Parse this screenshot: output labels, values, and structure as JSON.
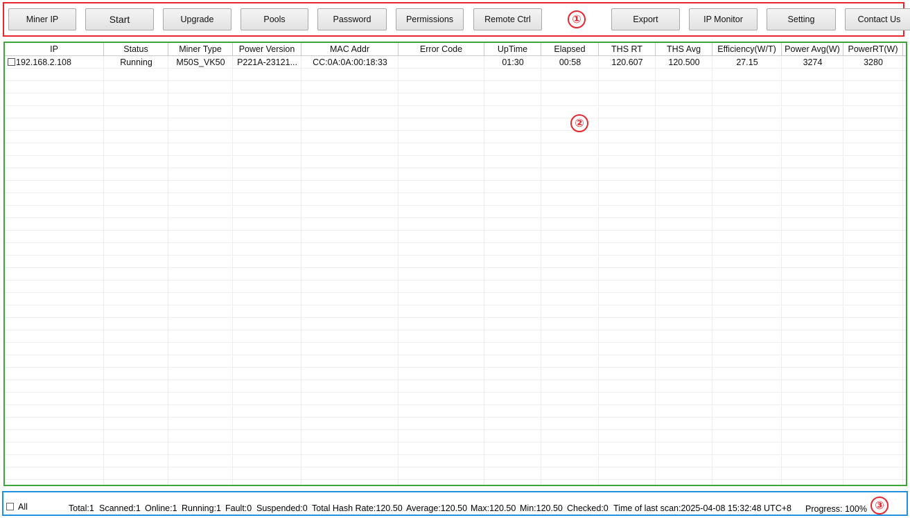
{
  "toolbar": {
    "buttons": [
      "Miner IP",
      "Start",
      "Upgrade",
      "Pools",
      "Password",
      "Permissions",
      "Remote Ctrl",
      "Export",
      "IP Monitor",
      "Setting",
      "Contact Us"
    ]
  },
  "annotations": {
    "badge1": "①",
    "badge2": "②",
    "badge3": "③"
  },
  "table": {
    "columns": [
      "IP",
      "Status",
      "Miner Type",
      "Power Version",
      "MAC Addr",
      "Error Code",
      "UpTime",
      "Elapsed",
      "THS RT",
      "THS Avg",
      "Efficiency(W/T)",
      "Power Avg(W)",
      "PowerRT(W)"
    ],
    "rows": [
      {
        "ip": "192.168.2.108",
        "status": "Running",
        "miner_type": "M50S_VK50",
        "power_version": "P221A-23121...",
        "mac": "CC:0A:0A:00:18:33",
        "error_code": "",
        "uptime": "01:30",
        "elapsed": "00:58",
        "ths_rt": "120.607",
        "ths_avg": "120.500",
        "efficiency": "27.15",
        "power_avg": "3274",
        "power_rt": "3280"
      }
    ]
  },
  "status": {
    "all_label": "All",
    "total": "Total:1",
    "scanned": "Scanned:1",
    "online": "Online:1",
    "running": "Running:1",
    "fault": "Fault:0",
    "suspended": "Suspended:0",
    "total_hash": "Total Hash Rate:120.50",
    "average": "Average:120.50",
    "max": "Max:120.50",
    "min": "Min:120.50",
    "checked": "Checked:0",
    "last_scan": "Time of last scan:2025-04-08 15:32:48 UTC+8",
    "progress": "Progress: 100%"
  },
  "colors": {
    "toolbar_frame": "#e8262d",
    "grid_frame": "#3aa63a",
    "status_frame": "#1e90e0"
  }
}
